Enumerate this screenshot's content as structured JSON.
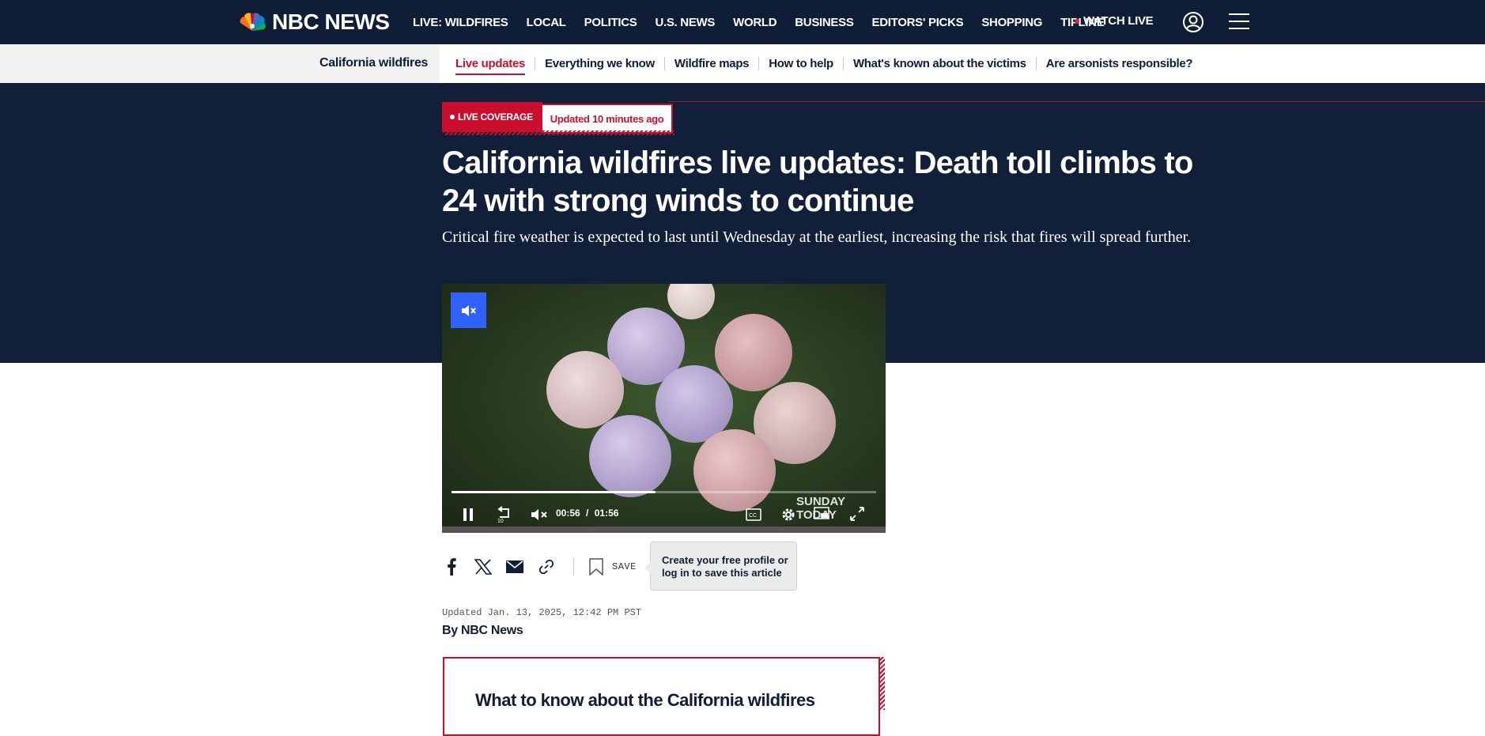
{
  "brand": {
    "name": "NBC NEWS"
  },
  "topnav": {
    "items": [
      "LIVE: WILDFIRES",
      "LOCAL",
      "POLITICS",
      "U.S. NEWS",
      "WORLD",
      "BUSINESS",
      "EDITORS' PICKS",
      "SHOPPING",
      "TIPLINE"
    ],
    "watch_live": "WATCH LIVE",
    "user_icon": "user-circle-icon",
    "menu_icon": "hamburger-menu-icon"
  },
  "subnav": {
    "title": "California wildfires",
    "links": [
      "Live updates",
      "Everything we know",
      "Wildfire maps",
      "How to help",
      "What's known about the victims",
      "Are arsonists responsible?"
    ],
    "active_index": 0
  },
  "article": {
    "badge_live": "LIVE COVERAGE",
    "badge_updated": "Updated 10 minutes ago",
    "headline": "California wildfires live updates: Death toll climbs to 24 with strong winds to continue",
    "dek": "Critical fire weather is expected to last until Wednesday at the earliest, increasing the risk that fires will spread further.",
    "updated": "Updated Jan. 13, 2025, 12:42 PM PST",
    "byline_prefix": "By ",
    "byline_author": "NBC News",
    "know_box_title": "What to know about the California wildfires"
  },
  "video": {
    "current_time": "00:56",
    "separator": "/",
    "duration": "01:56",
    "progress": 0.48,
    "watermark": "SUNDAY TODAY",
    "accent_color": "#3061ff"
  },
  "share": {
    "save_label": "SAVE",
    "tooltip": "Create your free profile or log in to save this article"
  },
  "colors": {
    "nav_bg": "#0f1d36",
    "hero_bg": "#112038",
    "brand_red": "#c8102e"
  }
}
